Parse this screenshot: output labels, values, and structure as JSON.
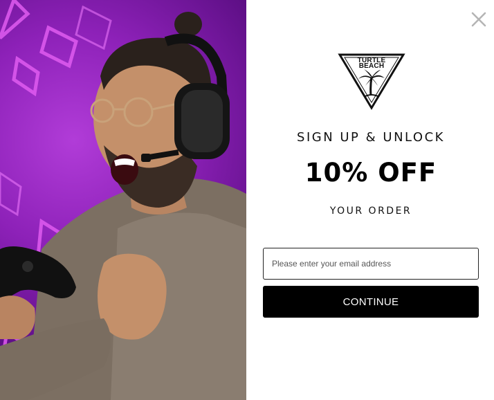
{
  "brand": {
    "logo_line_1": "TURTLE",
    "logo_line_2": "BEACH",
    "registered_mark": "®"
  },
  "hero": {
    "image": "gamer-with-headset-and-controller"
  },
  "close": {
    "icon": "close-icon"
  },
  "headline": {
    "line_1": "SIGN UP & UNLOCK",
    "line_2": "10% OFF",
    "line_3": "YOUR ORDER"
  },
  "form": {
    "email_placeholder": "Please enter your email address",
    "email_value": "",
    "submit_label": "CONTINUE"
  },
  "colors": {
    "hero_purple": "#8d21b8",
    "accent_pink": "#e04df0",
    "button_bg": "#000000",
    "text": "#111111"
  }
}
